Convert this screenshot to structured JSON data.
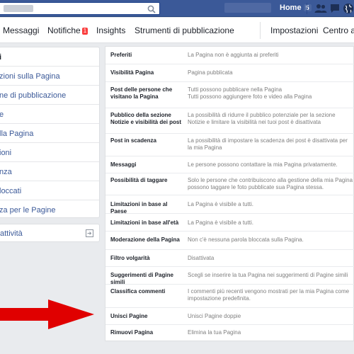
{
  "topbar": {
    "home_label": "Home",
    "home_count": "5"
  },
  "nav": {
    "messaggi": "Messaggi",
    "notifiche": "Notifiche",
    "notifiche_count": "1",
    "insights": "Insights",
    "strumenti": "Strumenti di pubblicazione",
    "impostazioni": "Impostazioni",
    "centro": "Centro ass"
  },
  "leftmenu": {
    "items": [
      {
        "label": "i"
      },
      {
        "label": "zioni sulla Pagina"
      },
      {
        "label": "ne di pubblicazione"
      },
      {
        "label": "e"
      },
      {
        "label": "lla Pagina"
      },
      {
        "label": "ioni"
      },
      {
        "label": "nza"
      },
      {
        "label": "loccati"
      },
      {
        "label": "za per le Pagine"
      }
    ],
    "activity_label": "attività"
  },
  "settings": {
    "rows": [
      {
        "label": "Preferiti",
        "value": "La Pagina non è aggiunta ai preferiti"
      },
      {
        "label": "Visibilità Pagina",
        "value": "Pagina pubblicata"
      },
      {
        "label": "Post delle persone che visitano la Pagina",
        "value": "Tutti possono pubblicare nella Pagina\nTutti possono aggiungere foto e video alla Pagina"
      },
      {
        "label": "Pubblico della sezione Notizie e visibilità dei post",
        "value": "La possibilità di ridurre il pubblico potenziale per la sezione Notizie e limitare la visibilità nei tuoi post è disattivata"
      },
      {
        "label": "Post in scadenza",
        "value": "La possibilità di impostare la scadenza dei post è disattivata per la mia Pagina"
      },
      {
        "label": "Messaggi",
        "value": "Le persone possono contattare la mia Pagina privatamente."
      },
      {
        "label": "Possibilità di taggare",
        "value": "Solo le persone che contribuiscono alla gestione della mia Pagina possono taggare le foto pubblicate sua Pagina stessa."
      },
      {
        "label": "Limitazioni in base al Paese",
        "value": "La Pagina è visibile a tutti."
      },
      {
        "label": "Limitazioni in base all'età",
        "value": "La Pagina è visibile a tutti."
      },
      {
        "label": "Moderazione della Pagina",
        "value": "Non c'è nessuna parola bloccata sulla Pagina."
      },
      {
        "label": "Filtro volgarità",
        "value": "Disattivata"
      },
      {
        "label": "Suggerimenti di Pagine simili",
        "value": "Scegli se inserire la tua Pagina nei suggerimenti di Pagine simili"
      },
      {
        "label": "Classifica commenti",
        "value": "I commenti più recenti vengono mostrati per la mia Pagina come impostazione predefinita."
      },
      {
        "label": "Unisci Pagine",
        "value": "Unisci Pagine doppie"
      },
      {
        "label": "Rimuovi Pagina",
        "value": "Elimina la tua Pagina"
      }
    ]
  },
  "colors": {
    "brand": "#3b5998",
    "arrow": "#e00000",
    "badge": "#fa3e3e"
  },
  "icons": [
    "search-icon",
    "friends-icon",
    "messages-icon",
    "globe-icon",
    "exit-icon",
    "red-arrow"
  ]
}
